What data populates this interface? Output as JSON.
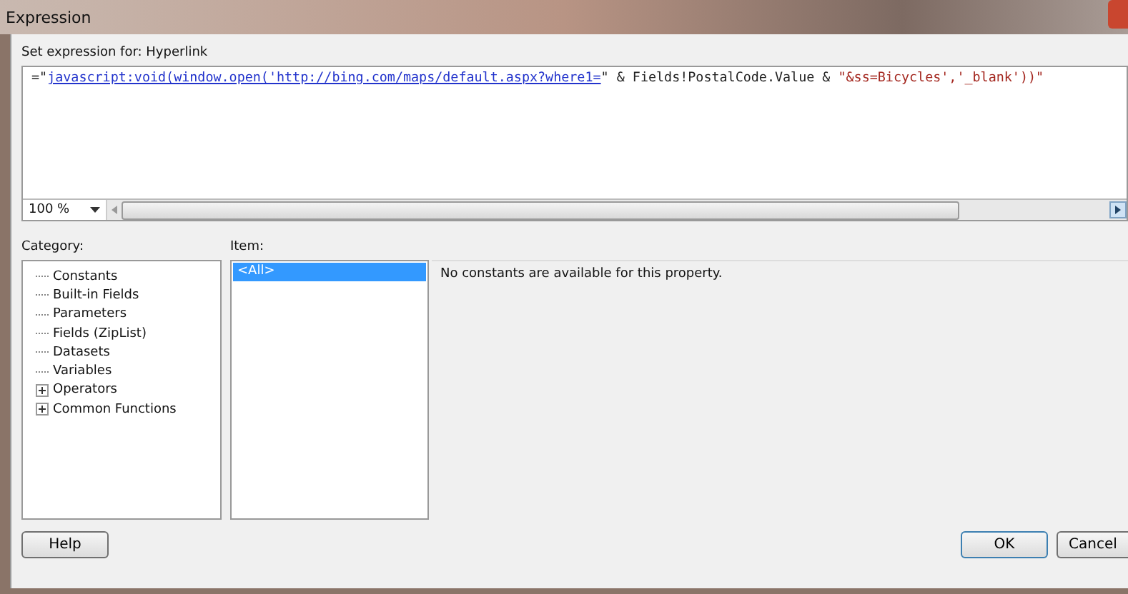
{
  "window": {
    "title": "Expression"
  },
  "editor": {
    "label": "Set expression for: Hyperlink",
    "segments": [
      {
        "kind": "plain",
        "text": "=\""
      },
      {
        "kind": "link",
        "text": "javascript:void(window.open('http://bing.com/maps/default.aspx?where1="
      },
      {
        "kind": "plain",
        "text": "\" & Fields!PostalCode.Value & "
      },
      {
        "kind": "string",
        "text": "\"&ss=Bicycles','_blank'))\""
      }
    ],
    "zoom": "100 %"
  },
  "category": {
    "label": "Category:",
    "items": [
      {
        "label": "Constants",
        "kind": "leaf"
      },
      {
        "label": "Built-in Fields",
        "kind": "leaf"
      },
      {
        "label": "Parameters",
        "kind": "leaf"
      },
      {
        "label": "Fields (ZipList)",
        "kind": "leaf"
      },
      {
        "label": "Datasets",
        "kind": "leaf"
      },
      {
        "label": "Variables",
        "kind": "leaf"
      },
      {
        "label": "Operators",
        "kind": "expandable"
      },
      {
        "label": "Common Functions",
        "kind": "expandable"
      }
    ]
  },
  "item": {
    "label": "Item:",
    "items": [
      {
        "label": "<All>",
        "selected": true
      }
    ]
  },
  "description": "No constants are available for this property.",
  "buttons": {
    "help": "Help",
    "ok": "OK",
    "cancel": "Cancel"
  }
}
